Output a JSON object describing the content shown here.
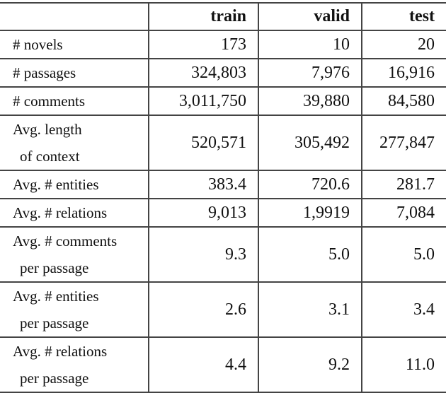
{
  "table": {
    "columns": [
      "",
      "train",
      "valid",
      "test"
    ],
    "rows": [
      {
        "label": [
          "# novels"
        ],
        "values": [
          "173",
          "10",
          "20"
        ]
      },
      {
        "label": [
          "# passages"
        ],
        "values": [
          "324,803",
          "7,976",
          "16,916"
        ]
      },
      {
        "label": [
          "# comments"
        ],
        "values": [
          "3,011,750",
          "39,880",
          "84,580"
        ]
      },
      {
        "label": [
          "Avg. length",
          "of context"
        ],
        "values": [
          "520,571",
          "305,492",
          "277,847"
        ]
      },
      {
        "label": [
          "Avg. # entities"
        ],
        "values": [
          "383.4",
          "720.6",
          "281.7"
        ]
      },
      {
        "label": [
          "Avg. # relations"
        ],
        "values": [
          "9,013",
          "1,9919",
          "7,084"
        ]
      },
      {
        "label": [
          "Avg. # comments",
          "per passage"
        ],
        "values": [
          "9.3",
          "5.0",
          "5.0"
        ]
      },
      {
        "label": [
          "Avg. # entities",
          "per passage"
        ],
        "values": [
          "2.6",
          "3.1",
          "3.4"
        ]
      },
      {
        "label": [
          "Avg. # relations",
          "per passage"
        ],
        "values": [
          "4.4",
          "9.2",
          "11.0"
        ]
      }
    ]
  }
}
